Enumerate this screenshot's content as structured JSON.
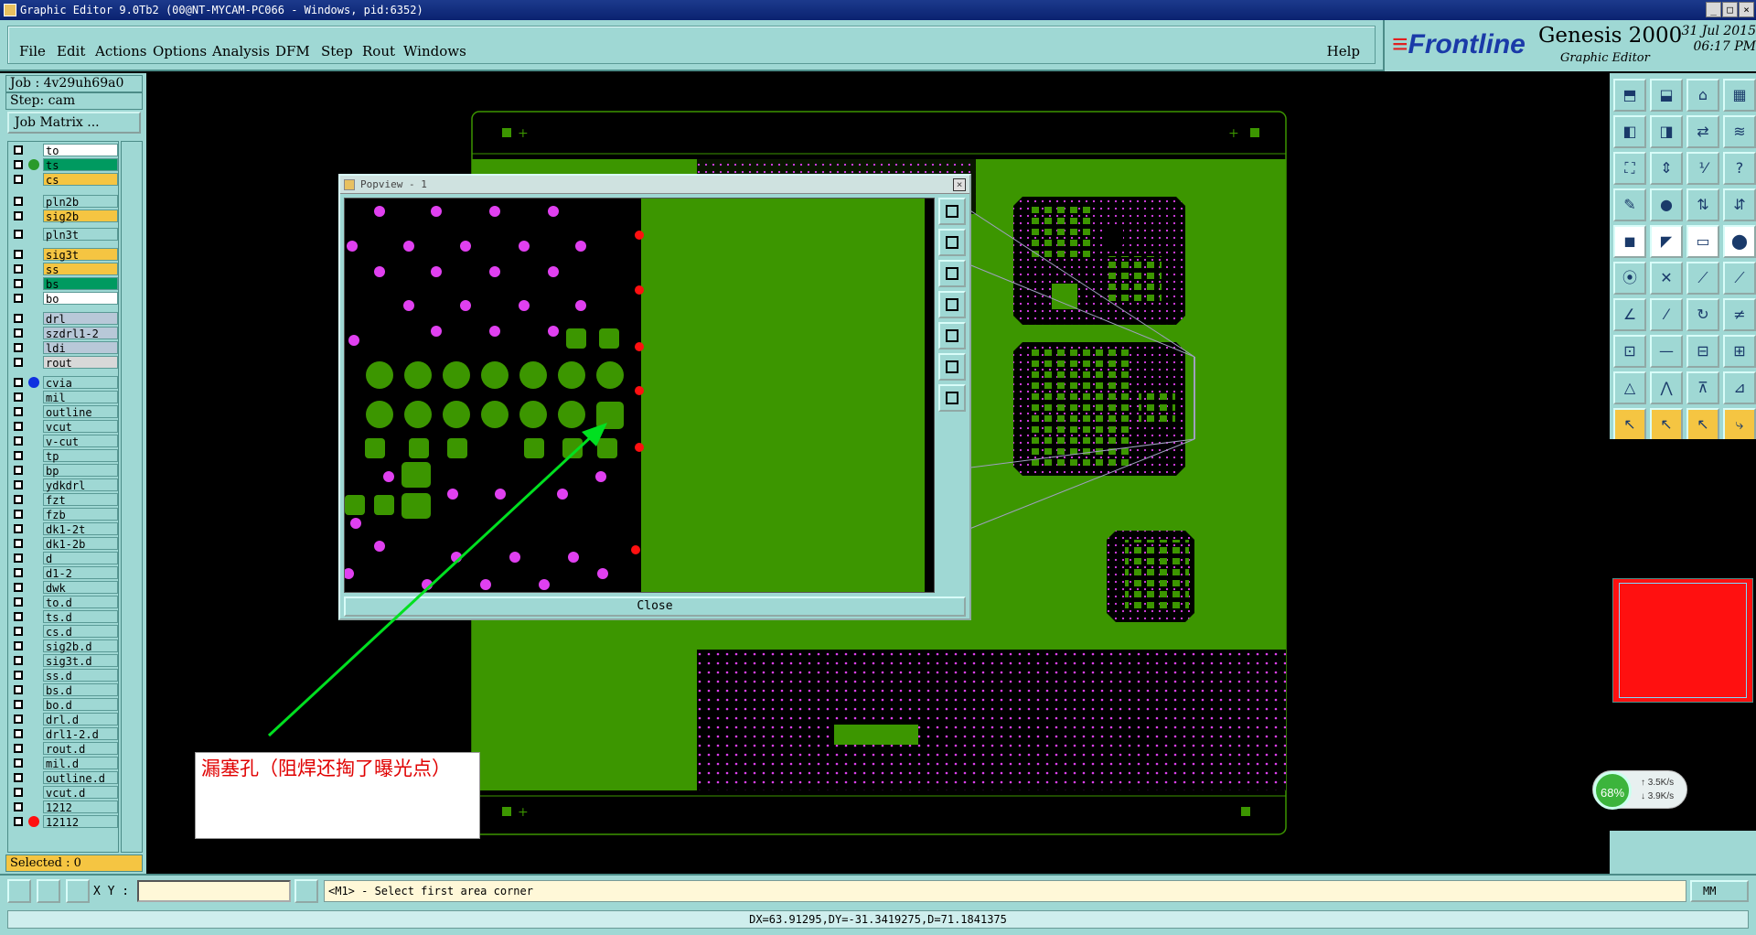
{
  "window": {
    "title": "Graphic Editor 9.0Tb2 (00@NT-MYCAM-PC066 - Windows, pid:6352)"
  },
  "menus": [
    "File",
    "Edit",
    "Actions",
    "Options",
    "Analysis",
    "DFM",
    "Step",
    "Rout",
    "Windows"
  ],
  "help_label": "Help",
  "brand": {
    "logo": "Frontline",
    "product": "Genesis 2000",
    "subtitle": "Graphic Editor",
    "date": "31 Jul 2015",
    "time": "06:17 PM"
  },
  "job": {
    "job_label": "Job : 4v29uh69a0",
    "step_label": "Step: cam",
    "job_matrix_button": "Job Matrix ..."
  },
  "layers": [
    {
      "name": "to",
      "bg": "#ffffff",
      "dot": ""
    },
    {
      "name": "ts",
      "bg": "#009a60",
      "dot": "#2a9a2a"
    },
    {
      "name": "cs",
      "bg": "#f5c542",
      "dot": ""
    },
    {
      "name": "pln2b",
      "bg": "#9fd8d4",
      "dot": ""
    },
    {
      "name": "sig2b",
      "bg": "#f5c542",
      "dot": ""
    },
    {
      "name": "pln3t",
      "bg": "#9fd8d4",
      "dot": ""
    },
    {
      "name": "sig3t",
      "bg": "#f5c542",
      "dot": ""
    },
    {
      "name": "ss",
      "bg": "#f5c542",
      "dot": ""
    },
    {
      "name": "bs",
      "bg": "#009a60",
      "dot": ""
    },
    {
      "name": "bo",
      "bg": "#ffffff",
      "dot": ""
    },
    {
      "name": "drl",
      "bg": "#b8c8d8",
      "dot": ""
    },
    {
      "name": "szdrl1-2",
      "bg": "#b8c8d8",
      "dot": ""
    },
    {
      "name": "ldi",
      "bg": "#b8c8d8",
      "dot": ""
    },
    {
      "name": "rout",
      "bg": "#d8d8d8",
      "dot": ""
    },
    {
      "name": "cvia",
      "bg": "#9fd8d4",
      "dot": "#1030e0"
    },
    {
      "name": "mil",
      "bg": "#9fd8d4",
      "dot": ""
    },
    {
      "name": "outline",
      "bg": "#9fd8d4",
      "dot": ""
    },
    {
      "name": "vcut",
      "bg": "#9fd8d4",
      "dot": ""
    },
    {
      "name": "v-cut",
      "bg": "#9fd8d4",
      "dot": ""
    },
    {
      "name": "tp",
      "bg": "#9fd8d4",
      "dot": ""
    },
    {
      "name": "bp",
      "bg": "#9fd8d4",
      "dot": ""
    },
    {
      "name": "ydkdrl",
      "bg": "#9fd8d4",
      "dot": ""
    },
    {
      "name": "fzt",
      "bg": "#9fd8d4",
      "dot": ""
    },
    {
      "name": "fzb",
      "bg": "#9fd8d4",
      "dot": ""
    },
    {
      "name": "dk1-2t",
      "bg": "#9fd8d4",
      "dot": ""
    },
    {
      "name": "dk1-2b",
      "bg": "#9fd8d4",
      "dot": ""
    },
    {
      "name": "d",
      "bg": "#9fd8d4",
      "dot": ""
    },
    {
      "name": "d1-2",
      "bg": "#9fd8d4",
      "dot": ""
    },
    {
      "name": "dwk",
      "bg": "#9fd8d4",
      "dot": ""
    },
    {
      "name": "to.d",
      "bg": "#9fd8d4",
      "dot": ""
    },
    {
      "name": "ts.d",
      "bg": "#9fd8d4",
      "dot": ""
    },
    {
      "name": "cs.d",
      "bg": "#9fd8d4",
      "dot": ""
    },
    {
      "name": "sig2b.d",
      "bg": "#9fd8d4",
      "dot": ""
    },
    {
      "name": "sig3t.d",
      "bg": "#9fd8d4",
      "dot": ""
    },
    {
      "name": "ss.d",
      "bg": "#9fd8d4",
      "dot": ""
    },
    {
      "name": "bs.d",
      "bg": "#9fd8d4",
      "dot": ""
    },
    {
      "name": "bo.d",
      "bg": "#9fd8d4",
      "dot": ""
    },
    {
      "name": "drl.d",
      "bg": "#9fd8d4",
      "dot": ""
    },
    {
      "name": "drl1-2.d",
      "bg": "#9fd8d4",
      "dot": ""
    },
    {
      "name": "rout.d",
      "bg": "#9fd8d4",
      "dot": ""
    },
    {
      "name": "mil.d",
      "bg": "#9fd8d4",
      "dot": ""
    },
    {
      "name": "outline.d",
      "bg": "#9fd8d4",
      "dot": ""
    },
    {
      "name": "vcut.d",
      "bg": "#9fd8d4",
      "dot": ""
    },
    {
      "name": "1212",
      "bg": "#9fd8d4",
      "dot": ""
    },
    {
      "name": "12112",
      "bg": "#9fd8d4",
      "dot": "#ff1010"
    }
  ],
  "selected_label": "Selected : 0",
  "popview": {
    "title": "Popview - 1",
    "close_label": "Close"
  },
  "annotation": "漏塞孔（阻焊还掏了曝光点）",
  "xy_label": "X Y :",
  "xy_value": "",
  "prompt": "<M1> - Select first area corner",
  "units": "MM",
  "status": "DX=63.91295,DY=-31.3419275,D=71.1841375",
  "network": {
    "percent": "68%",
    "up": "3.5K/s",
    "down": "3.9K/s"
  },
  "colors": {
    "panel": "#9fd8d4",
    "board": "#3c9600",
    "pad": "#e040f0"
  }
}
